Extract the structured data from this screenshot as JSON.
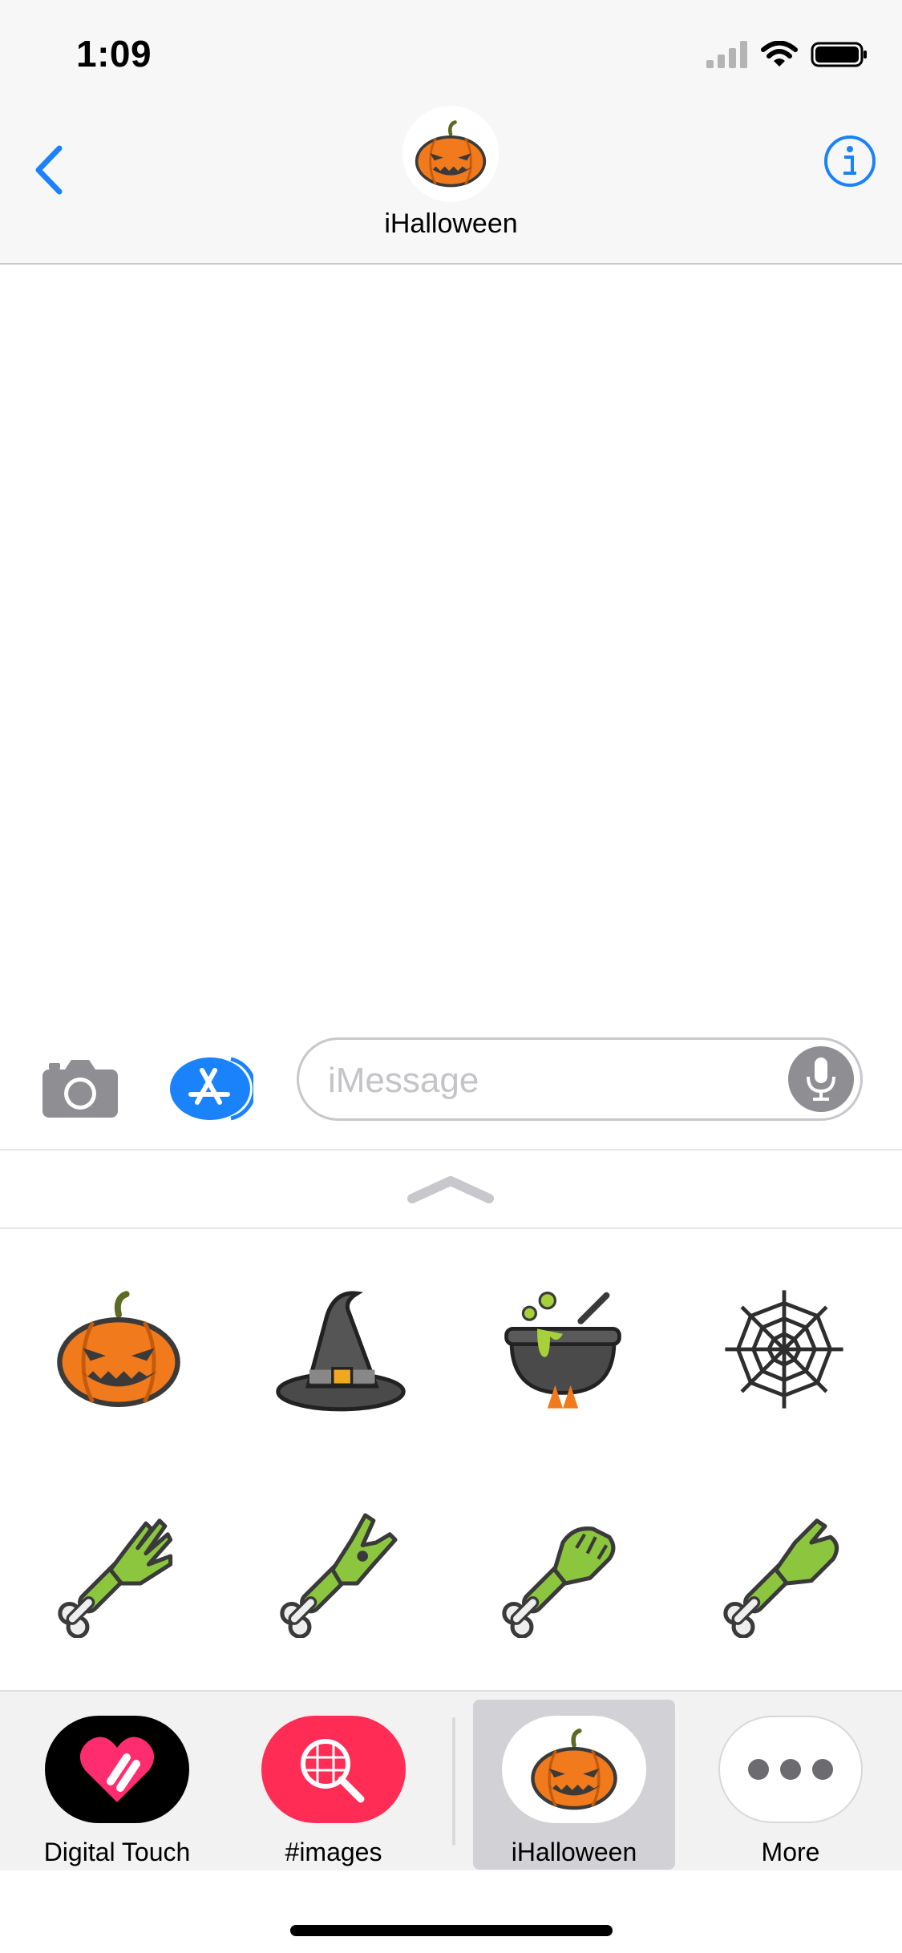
{
  "status_bar": {
    "time": "1:09",
    "icons": [
      "cellular-signal-icon",
      "wifi-icon",
      "battery-icon"
    ]
  },
  "nav": {
    "back_icon": "chevron-left-icon",
    "contact_name": "iHalloween",
    "info_icon": "info-icon"
  },
  "input_bar": {
    "camera_icon": "camera-icon",
    "appstore_icon": "app-store-icon",
    "placeholder": "iMessage",
    "mic_icon": "microphone-icon"
  },
  "drawer": {
    "handle_icon": "chevron-up-icon"
  },
  "stickers": [
    {
      "name": "jack-o-lantern"
    },
    {
      "name": "witch-hat"
    },
    {
      "name": "cauldron"
    },
    {
      "name": "spider-web"
    },
    {
      "name": "zombie-hand-open"
    },
    {
      "name": "zombie-hand-rock"
    },
    {
      "name": "zombie-hand-fist"
    },
    {
      "name": "zombie-hand-pointing"
    }
  ],
  "apps": [
    {
      "label": "Digital Touch",
      "icon": "digital-touch-icon",
      "selected": false
    },
    {
      "label": "#images",
      "icon": "images-search-icon",
      "selected": false
    },
    {
      "label": "iHalloween",
      "icon": "pumpkin-icon",
      "selected": true
    },
    {
      "label": "More",
      "icon": "more-icon",
      "selected": false
    }
  ],
  "colors": {
    "ios_blue": "#1a82fb",
    "pumpkin_orange": "#f07a1c",
    "zombie_green": "#8cc63f",
    "hashtag_pink": "#ff2d55",
    "digital_touch_pink": "#ff2d6f"
  }
}
